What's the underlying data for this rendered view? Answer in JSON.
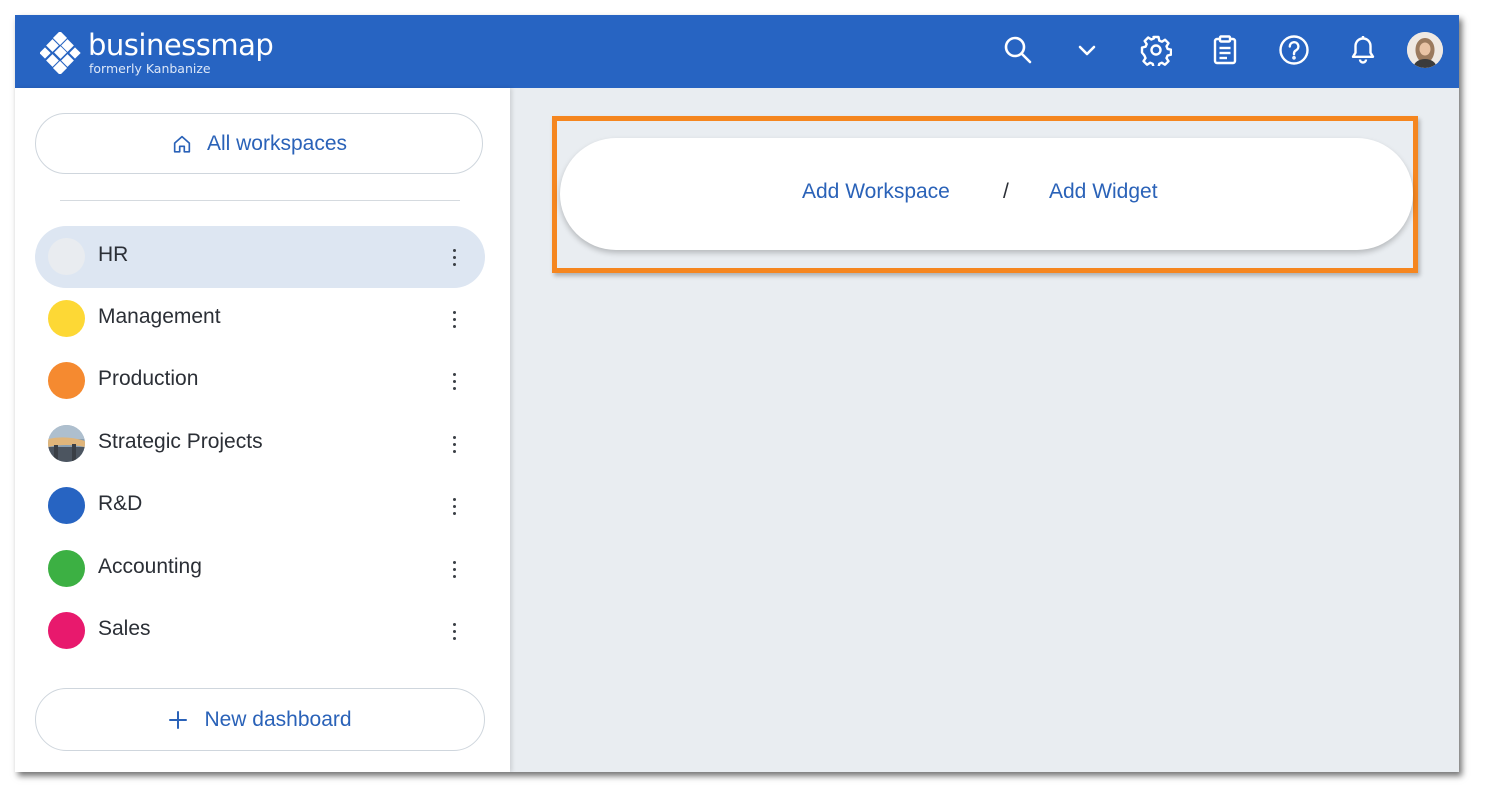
{
  "app": {
    "logo_name": "businessmap",
    "logo_sub": "formerly Kanbanize"
  },
  "topbar": {
    "icons": [
      "search-icon",
      "chevron-down-icon",
      "gear-icon",
      "clipboard-icon",
      "help-icon",
      "bell-icon"
    ],
    "background": "#2764c2"
  },
  "sidebar": {
    "all_workspaces_label": "All workspaces",
    "workspaces": [
      {
        "label": "HR",
        "color": "#e9ecf0",
        "active": true
      },
      {
        "label": "Management",
        "color": "#fdd835"
      },
      {
        "label": "Production",
        "color": "#f58a30"
      },
      {
        "label": "Strategic Projects",
        "color": "image"
      },
      {
        "label": "R&D",
        "color": "#2764c2"
      },
      {
        "label": "Accounting",
        "color": "#3cb043"
      },
      {
        "label": "Sales",
        "color": "#e8196d"
      }
    ],
    "new_dashboard_label": "New dashboard"
  },
  "main": {
    "add_workspace_label": "Add Workspace",
    "separator": "/",
    "add_widget_label": "Add Widget",
    "highlight_color": "#f5861f"
  }
}
